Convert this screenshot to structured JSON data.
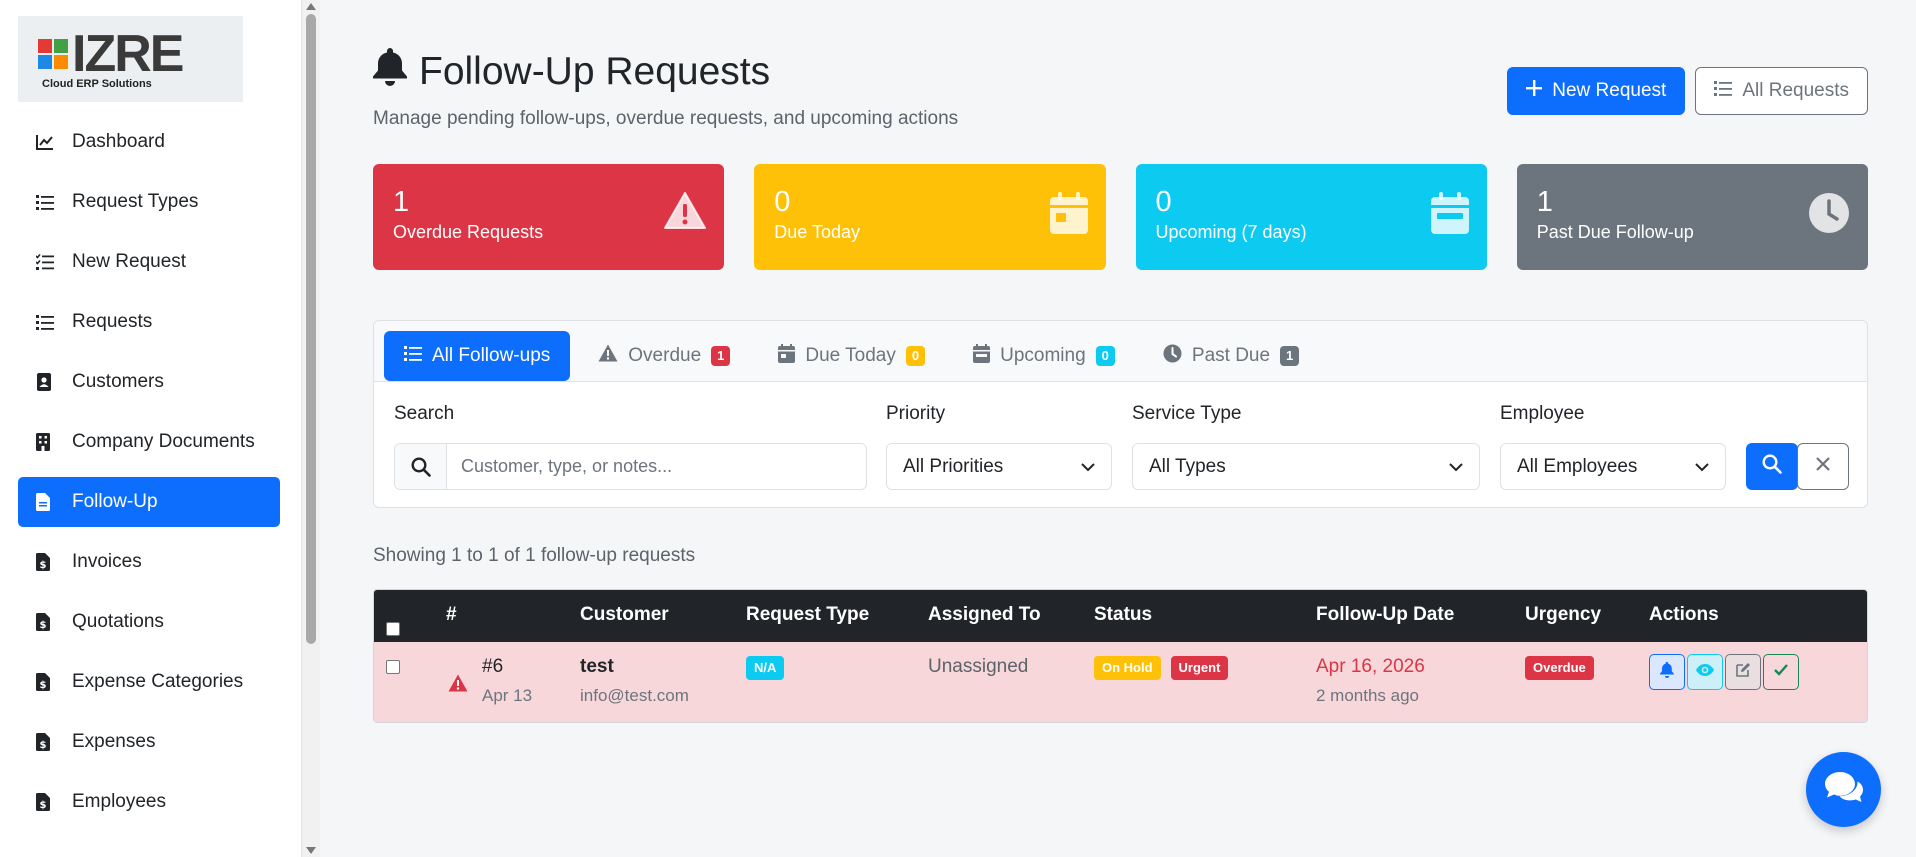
{
  "brand": {
    "logo_text": "IZRE",
    "logo_sub": "Cloud ERP Solutions"
  },
  "sidebar": {
    "items": [
      {
        "label": "Dashboard",
        "icon": "chart-line-icon",
        "active": false
      },
      {
        "label": "Request Types",
        "icon": "list-icon",
        "active": false
      },
      {
        "label": "New Request",
        "icon": "list-check-icon",
        "active": false
      },
      {
        "label": "Requests",
        "icon": "list-icon",
        "active": false
      },
      {
        "label": "Customers",
        "icon": "address-book-icon",
        "active": false
      },
      {
        "label": "Company Documents",
        "icon": "building-icon",
        "active": false
      },
      {
        "label": "Follow-Up",
        "icon": "file-icon",
        "active": true
      },
      {
        "label": "Invoices",
        "icon": "file-invoice-dollar-icon",
        "active": false
      },
      {
        "label": "Quotations",
        "icon": "file-invoice-dollar-icon",
        "active": false
      },
      {
        "label": "Expense Categories",
        "icon": "file-invoice-dollar-icon",
        "active": false
      },
      {
        "label": "Expenses",
        "icon": "file-invoice-dollar-icon",
        "active": false
      },
      {
        "label": "Employees",
        "icon": "file-invoice-dollar-icon",
        "active": false
      }
    ]
  },
  "header": {
    "title": "Follow-Up Requests",
    "subtitle": "Manage pending follow-ups, overdue requests, and upcoming actions",
    "new_request_label": "New Request",
    "all_requests_label": "All Requests"
  },
  "stats": [
    {
      "value": "1",
      "label": "Overdue Requests",
      "color": "#dc3545",
      "icon": "warning-triangle-icon"
    },
    {
      "value": "0",
      "label": "Due Today",
      "color": "#ffc107",
      "icon": "calendar-day-icon"
    },
    {
      "value": "0",
      "label": "Upcoming (7 days)",
      "color": "#0dcaf0",
      "icon": "calendar-week-icon"
    },
    {
      "value": "1",
      "label": "Past Due Follow-up",
      "color": "#6c757d",
      "icon": "clock-icon"
    }
  ],
  "tabs": [
    {
      "label": "All Follow-ups",
      "badge": "",
      "active": true
    },
    {
      "label": "Overdue",
      "badge": "1"
    },
    {
      "label": "Due Today",
      "badge": "0"
    },
    {
      "label": "Upcoming",
      "badge": "0"
    },
    {
      "label": "Past Due",
      "badge": "1"
    }
  ],
  "filters": {
    "search_label": "Search",
    "search_placeholder": "Customer, type, or notes...",
    "priority_label": "Priority",
    "priority_value": "All Priorities",
    "service_label": "Service Type",
    "service_value": "All Types",
    "employee_label": "Employee",
    "employee_value": "All Employees"
  },
  "showing_text": "Showing 1 to 1 of 1 follow-up requests",
  "table": {
    "headers": [
      "#",
      "Customer",
      "Request Type",
      "Assigned To",
      "Status",
      "Follow-Up Date",
      "Urgency",
      "Actions"
    ],
    "rows": [
      {
        "id": "#6",
        "date": "Apr 13",
        "customer": "test",
        "email": "info@test.com",
        "request_type": "N/A",
        "assigned_to": "Unassigned",
        "status": "On Hold",
        "priority": "Urgent",
        "follow_up_date": "Apr 16, 2026",
        "follow_up_relative": "2 months ago",
        "urgency": "Overdue"
      }
    ]
  },
  "colors": {
    "primary": "#0d6efd",
    "danger": "#dc3545",
    "warning": "#ffc107",
    "info": "#0dcaf0",
    "secondary": "#6c757d",
    "row_highlight": "#f8d7da"
  }
}
